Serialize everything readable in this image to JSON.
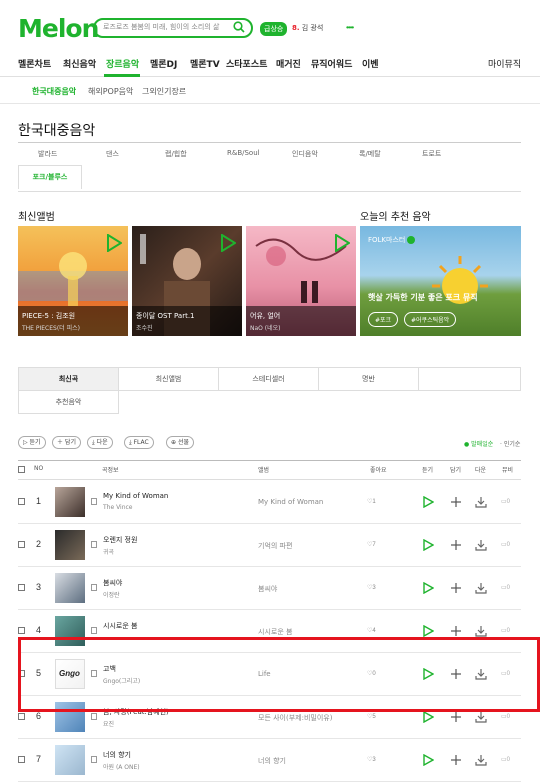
{
  "header": {
    "logo": "Melon",
    "search_placeholder": "로즈로즈 봄봄의 미래, 힘이의 소리의 삶",
    "badge": "급상승",
    "trend_rank": "8.",
    "trend_text": "김 광석"
  },
  "gnb": [
    "멜론차트",
    "최신음악",
    "장르음악",
    "멜론DJ",
    "멜론TV",
    "스타포스트",
    "매거진",
    "뮤직어워드",
    "이벤",
    "마이뮤직"
  ],
  "sub_nav": [
    "한국대중음악",
    "해외POP음악",
    "그외인기장르"
  ],
  "page_title": "한국대중음악",
  "genres": [
    "발라드",
    "댄스",
    "랩/힙합",
    "R&B/Soul",
    "인디음악",
    "록/메탈",
    "트로트"
  ],
  "genre_selected": "포크/블루스",
  "section_new": "최신앨범",
  "section_rec": "오늘의 추천 음악",
  "albums": [
    {
      "title": "PIECE-5 : 김조원",
      "artist": "THE PIECES(더 피스)"
    },
    {
      "title": "종이달 OST Part.1",
      "artist": "조수진"
    },
    {
      "title": "어유, 얼어",
      "artist": "NaO (네오)"
    }
  ],
  "rec": {
    "channel": "FOLK마스터",
    "headline": "햇살 가득한 기분 좋은 포크 뮤직",
    "tags": [
      "#포크",
      "#어쿠스틱음악"
    ]
  },
  "tabs": [
    "최신곡",
    "최신앨범",
    "스테디셀러",
    "명반",
    "추천음악"
  ],
  "buttons": [
    "듣기",
    "담기",
    "다운",
    "FLAC",
    "선물"
  ],
  "sort": {
    "active": "발매일순",
    "other": "인기순"
  },
  "table_head": {
    "no": "NO",
    "song": "곡정보",
    "album": "앨범",
    "like": "좋아요",
    "listen": "듣기",
    "add": "담기",
    "download": "다운",
    "mv": "뮤비"
  },
  "rows": [
    {
      "rank": "1",
      "title": "My Kind of Woman",
      "artist": "The Vince",
      "album": "My Kind of Woman",
      "likes": "1",
      "mv": "0"
    },
    {
      "rank": "2",
      "title": "오렌지 정원",
      "artist": "귀곡",
      "album": "기억의 파편",
      "likes": "7",
      "mv": "0"
    },
    {
      "rank": "3",
      "title": "봄씨야",
      "artist": "이정란",
      "album": "봄씨야",
      "likes": "3",
      "mv": "0"
    },
    {
      "rank": "4",
      "title": "시시로운 봄",
      "artist": "",
      "album": "시시로운 봄",
      "likes": "4",
      "mv": "0"
    },
    {
      "rank": "5",
      "title": "고백",
      "artist": "Gngo(그리고)",
      "album": "Life",
      "likes": "0",
      "mv": "0"
    },
    {
      "rank": "6",
      "title": "봄, 사랑(Feat.남예현)",
      "artist": "요진",
      "album": "모든 사이(부제:비밀이유)",
      "likes": "5",
      "mv": "0"
    },
    {
      "rank": "7",
      "title": "너의 향기",
      "artist": "아원 (A ONE)",
      "album": "너의 향기",
      "likes": "3",
      "mv": "0"
    }
  ],
  "colors": {
    "brand": "#1fb32e",
    "highlight": "#e5141e"
  }
}
